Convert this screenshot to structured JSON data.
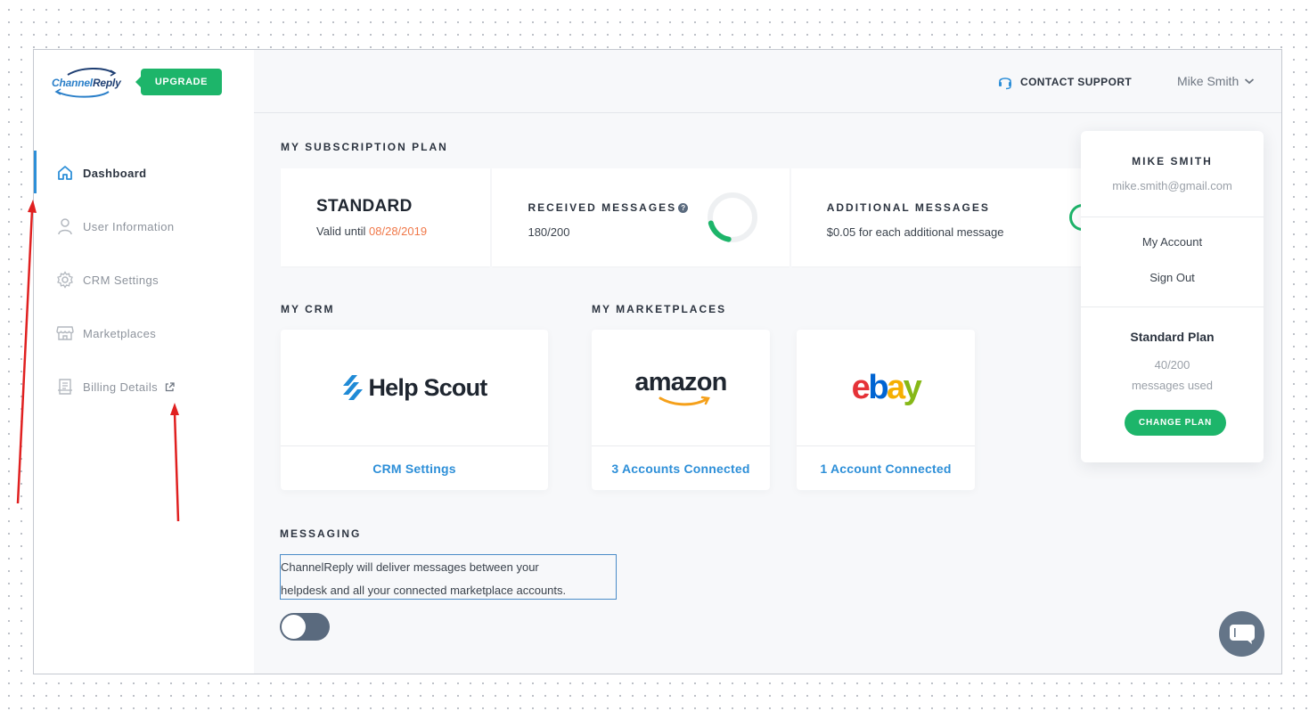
{
  "brand": {
    "logo_channel": "Channel",
    "logo_reply": "Reply",
    "upgrade_label": "UPGRADE"
  },
  "sidebar": {
    "items": [
      {
        "label": "Dashboard",
        "icon": "home-icon",
        "active": true
      },
      {
        "label": "User Information",
        "icon": "user-icon"
      },
      {
        "label": "CRM Settings",
        "icon": "gear-icon"
      },
      {
        "label": "Marketplaces",
        "icon": "store-icon"
      },
      {
        "label": "Billing Details",
        "icon": "receipt-icon",
        "external": true
      }
    ]
  },
  "header": {
    "support_label": "CONTACT SUPPORT",
    "user_name": "Mike Smith"
  },
  "subscription": {
    "section_title": "MY SUBSCRIPTION PLAN",
    "plan_name": "STANDARD",
    "valid_prefix": "Valid until ",
    "valid_date": "08/28/2019",
    "received_label": "RECEIVED MESSAGES",
    "received_value": "180/200",
    "received_fraction": 0.9,
    "additional_label": "ADDITIONAL MESSAGES",
    "additional_value": "$0.05 for each additional message"
  },
  "crm": {
    "section_title": "MY CRM",
    "name": "Help Scout",
    "link_label": "CRM Settings"
  },
  "marketplaces": {
    "section_title": "MY MARKETPLACES",
    "items": [
      {
        "name": "amazon",
        "link_label": "3 Accounts Connected"
      },
      {
        "name": "ebay",
        "link_label": "1 Account Connected"
      }
    ]
  },
  "messaging": {
    "section_title": "MESSAGING",
    "description_line1": "ChannelReply will deliver messages between your",
    "description_line2": "helpdesk and all your connected marketplace accounts.",
    "toggle_on": false
  },
  "dropdown": {
    "name": "MIKE SMITH",
    "email": "mike.smith@gmail.com",
    "my_account": "My Account",
    "sign_out": "Sign Out",
    "plan_name": "Standard Plan",
    "usage": "40/200",
    "usage_label": "messages used",
    "change_plan_label": "CHANGE PLAN"
  },
  "colors": {
    "accent_green": "#1db56a",
    "link_blue": "#2d8fd8",
    "date_orange": "#f07849",
    "annotation_red": "#e02020"
  }
}
